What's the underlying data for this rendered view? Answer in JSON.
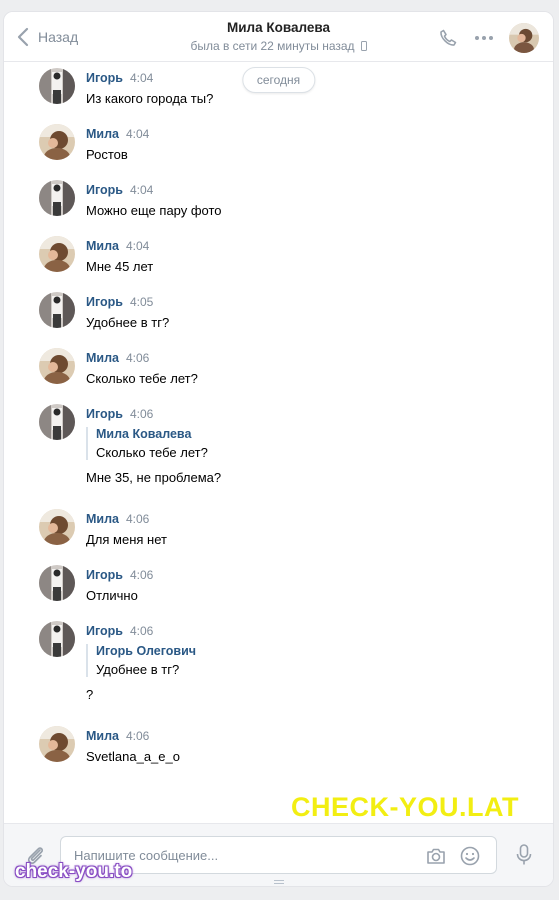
{
  "header": {
    "back_label": "Назад",
    "contact_name": "Мила Ковалева",
    "status": "была в сети 22 минуты назад"
  },
  "day_separator": "сегодня",
  "messages": [
    {
      "author": "Игорь",
      "time": "4:04",
      "text": "Из какого города ты?",
      "avatar": "igor"
    },
    {
      "author": "Мила",
      "time": "4:04",
      "text": "Ростов",
      "avatar": "mila"
    },
    {
      "author": "Игорь",
      "time": "4:04",
      "text": "Можно еще пару фото",
      "avatar": "igor"
    },
    {
      "author": "Мила",
      "time": "4:04",
      "text": "Мне 45 лет",
      "avatar": "mila"
    },
    {
      "author": "Игорь",
      "time": "4:05",
      "text": "Удобнее в тг?",
      "avatar": "igor"
    },
    {
      "author": "Мила",
      "time": "4:06",
      "text": "Сколько тебе лет?",
      "avatar": "mila"
    },
    {
      "author": "Игорь",
      "time": "4:06",
      "avatar": "igor",
      "forward": {
        "author": "Мила Ковалева",
        "text": "Сколько тебе лет?"
      },
      "text": "Мне 35, не проблема?"
    },
    {
      "author": "Мила",
      "time": "4:06",
      "text": "Для меня нет",
      "avatar": "mila"
    },
    {
      "author": "Игорь",
      "time": "4:06",
      "text": "Отлично",
      "avatar": "igor"
    },
    {
      "author": "Игорь",
      "time": "4:06",
      "avatar": "igor",
      "forward": {
        "author": "Игорь Олегович",
        "text": "Удобнее в тг?"
      },
      "text": "?"
    },
    {
      "author": "Мила",
      "time": "4:06",
      "text": "Svetlana_a_e_o",
      "avatar": "mila"
    }
  ],
  "composer": {
    "placeholder": "Напишите сообщение..."
  },
  "watermarks": {
    "main": "CHECK-YOU.LAT",
    "small": "check-you.to"
  },
  "colors": {
    "link": "#2a5885",
    "muted": "#818c99",
    "background": "#edeef0",
    "watermark_main": "#f2ee12"
  }
}
